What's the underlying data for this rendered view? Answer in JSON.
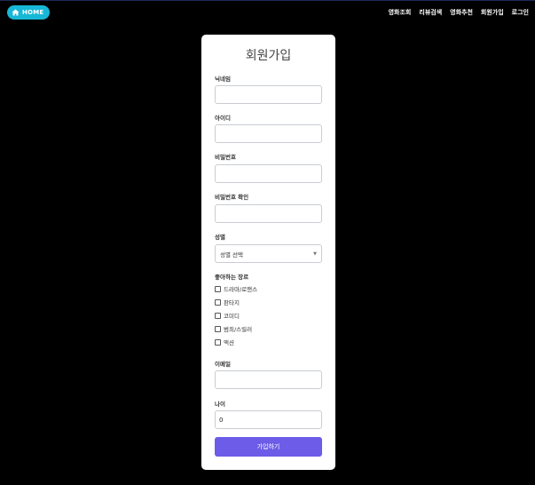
{
  "nav": {
    "home_label": "HOME",
    "items": [
      "영화조회",
      "리뷰검색",
      "영화추천",
      "회원가입",
      "로그인"
    ]
  },
  "form": {
    "title": "회원가입",
    "nickname_label": "닉네임",
    "nickname_value": "",
    "id_label": "아이디",
    "id_value": "",
    "password_label": "비밀번호",
    "password_value": "",
    "password_confirm_label": "비밀번호 확인",
    "password_confirm_value": "",
    "gender_label": "성별",
    "gender_selected": "성별 선택",
    "genres_label": "좋아하는 장르",
    "genres": [
      {
        "label": "드라마/로맨스",
        "checked": false
      },
      {
        "label": "판타지",
        "checked": false
      },
      {
        "label": "코미디",
        "checked": false
      },
      {
        "label": "범죄/스릴러",
        "checked": false
      },
      {
        "label": "액션",
        "checked": false
      }
    ],
    "email_label": "이메일",
    "email_value": "",
    "age_label": "나이",
    "age_value": "0",
    "submit_label": "가입하기"
  },
  "colors": {
    "accent_home": "#17b7d6",
    "submit": "#6c5ce7",
    "background": "#000000"
  },
  "icons": {
    "home": "home-icon",
    "select": "chevron-down-icon"
  }
}
